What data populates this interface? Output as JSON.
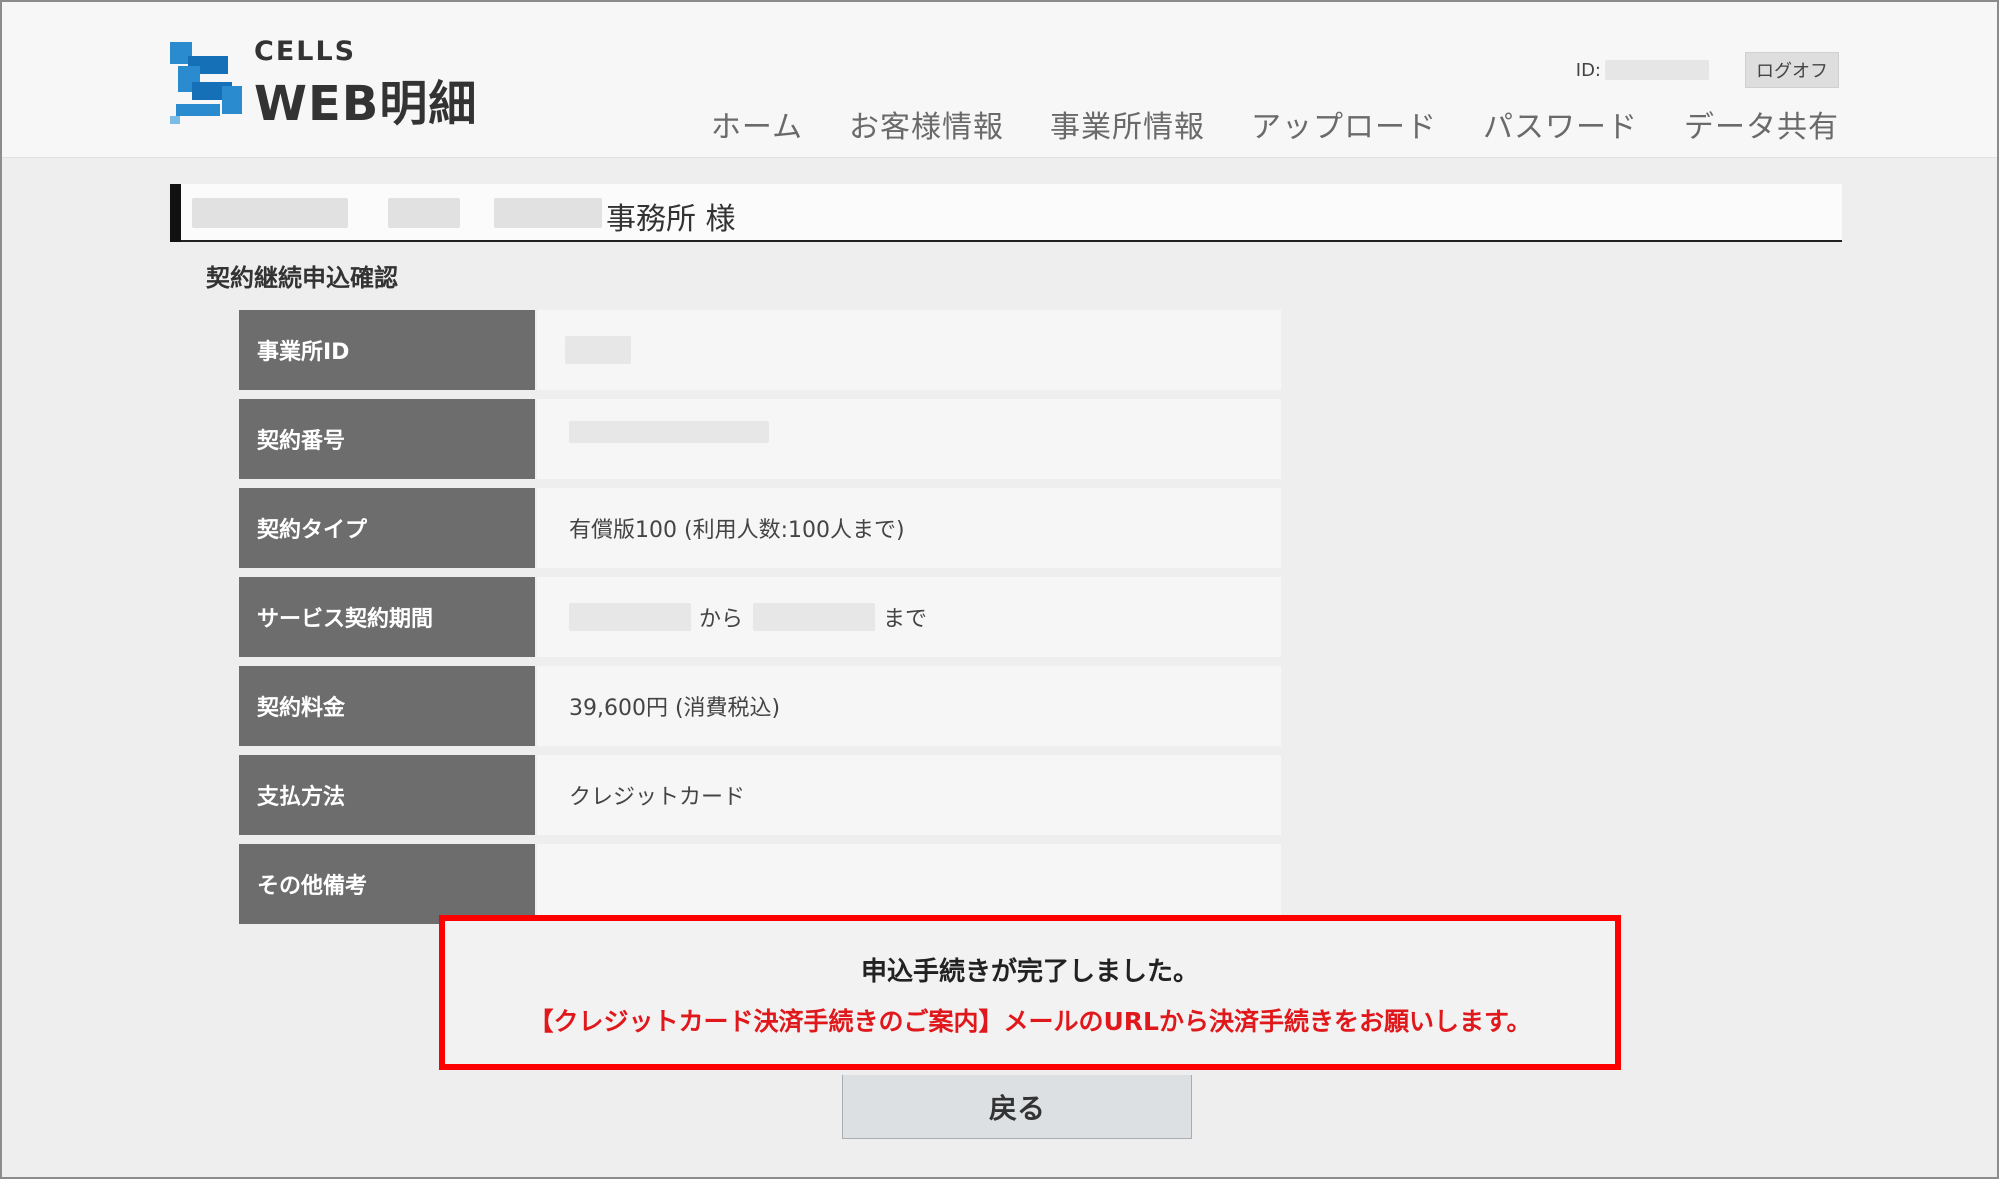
{
  "header": {
    "logo_top": "CELLS",
    "logo_main": "WEB明細",
    "id_label": "ID:",
    "logoff_label": "ログオフ",
    "nav": [
      "ホーム",
      "お客様情報",
      "事業所情報",
      "アップロード",
      "パスワード",
      "データ共有"
    ]
  },
  "office": {
    "suffix": "事務所 様"
  },
  "section_title": "契約継続申込確認",
  "rows": [
    {
      "label": "事業所ID",
      "value": ""
    },
    {
      "label": "契約番号",
      "value": ""
    },
    {
      "label": "契約タイプ",
      "value": "有償版100 (利用人数:100人まで)"
    },
    {
      "label": "サービス契約期間",
      "from_text": "から",
      "to_text": "まで"
    },
    {
      "label": "契約料金",
      "value": "39,600円 (消費税込)"
    },
    {
      "label": "支払方法",
      "value": "クレジットカード"
    },
    {
      "label": "その他備考",
      "value": ""
    }
  ],
  "notice": {
    "title": "申込手続きが完了しました。",
    "message": "【クレジットカード決済手続きのご案内】メールのURLから決済手続きをお願いします。"
  },
  "back_button": "戻る",
  "colors": {
    "header_cell": "#6d6d6d",
    "notice_border": "#ff0000",
    "notice_text": "#e0181b"
  }
}
